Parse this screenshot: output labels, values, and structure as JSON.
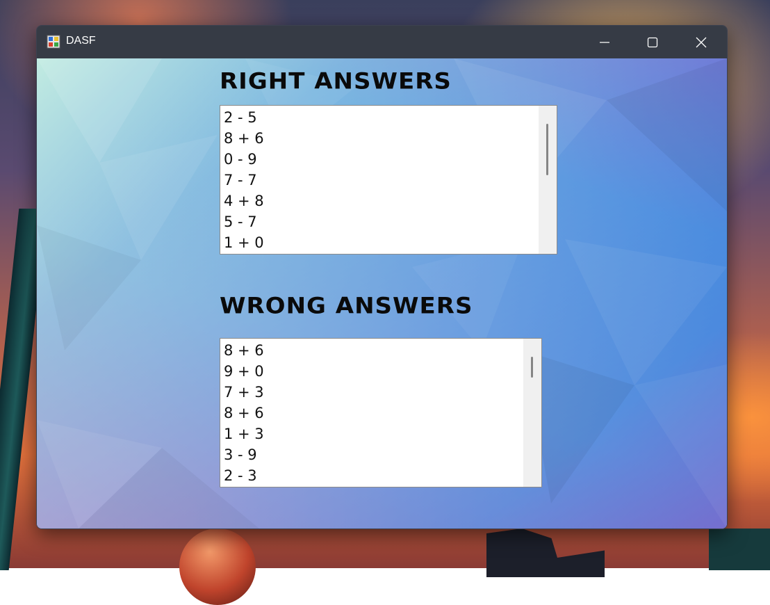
{
  "window": {
    "title": "DASF"
  },
  "right_answers": {
    "heading": "RIGHT ANSWERS",
    "items": [
      "2 - 5",
      "8 + 6",
      "0 - 9",
      "7 - 7",
      "4 + 8",
      "5 - 7",
      "1 + 0"
    ]
  },
  "wrong_answers": {
    "heading": "WRONG ANSWERS",
    "items": [
      "8 + 6",
      "9 + 0",
      "7 + 3",
      "8 + 6",
      "1 + 3",
      "3 - 9",
      "2 - 3"
    ]
  },
  "icons": {
    "app": "app-icon",
    "minimize": "minimize-icon",
    "maximize": "maximize-icon",
    "close": "close-icon"
  },
  "colors": {
    "titlebar": "#363b45",
    "heading_text": "#0a0a0a",
    "list_background": "#ffffff",
    "scrollbar_track": "#f0f0f0",
    "scrollbar_thumb": "#858585"
  }
}
